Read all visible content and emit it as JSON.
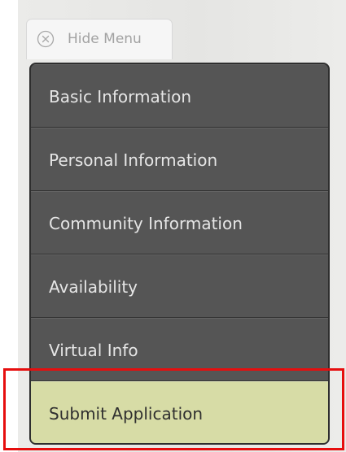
{
  "hide_menu": {
    "label": "Hide Menu",
    "icon": "close-circle-icon"
  },
  "menu": {
    "items": [
      {
        "label": "Basic Information",
        "active": false
      },
      {
        "label": "Personal Information",
        "active": false
      },
      {
        "label": "Community Information",
        "active": false
      },
      {
        "label": "Availability",
        "active": false
      },
      {
        "label": "Virtual Info",
        "active": false
      },
      {
        "label": "Submit Application",
        "active": true
      }
    ]
  },
  "colors": {
    "menu_background": "#555555",
    "active_item": "#d7dca6",
    "highlight_border": "#e60e0e"
  }
}
